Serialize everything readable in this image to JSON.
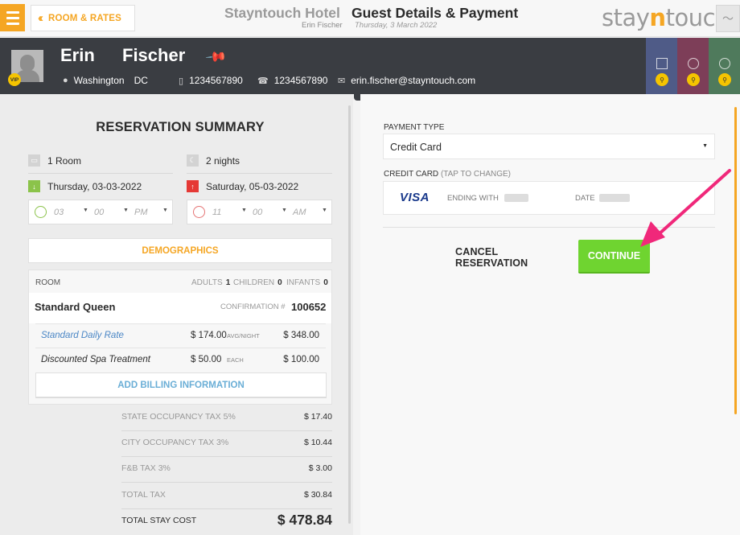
{
  "topbar": {
    "back_label": "ROOM & RATES",
    "hotel_name": "Stayntouch Hotel",
    "hotel_user": "Erin Fischer",
    "page_title": "Guest Details & Payment",
    "page_date": "Thursday, 3 March 2022",
    "logo_prefix": "stay",
    "logo_accent": "n",
    "logo_suffix": "touch"
  },
  "guest": {
    "first_name": "Erin",
    "last_name": "Fischer",
    "vip_badge": "VIP",
    "city": "Washington",
    "state": "DC",
    "mobile": "1234567890",
    "phone": "1234567890",
    "email": "erin.fischer@stayntouch.com",
    "tile_colors": [
      "#4f5b87",
      "#7d3e58",
      "#4f7a5c"
    ]
  },
  "summary": {
    "title": "RESERVATION SUMMARY",
    "rooms": "1 Room",
    "nights": "2 nights",
    "arrival": "Thursday, 03-03-2022",
    "departure": "Saturday, 05-03-2022",
    "arrival_time": {
      "hour": "03",
      "minute": "00",
      "ampm": "PM"
    },
    "departure_time": {
      "hour": "11",
      "minute": "00",
      "ampm": "AM"
    },
    "demographics_label": "DEMOGRAPHICS",
    "room_label": "ROOM",
    "adults_label": "ADULTS",
    "adults": "1",
    "children_label": "CHILDREN",
    "children": "0",
    "infants_label": "INFANTS",
    "infants": "0",
    "room_type": "Standard Queen",
    "confirmation_label": "CONFIRMATION #",
    "confirmation": "100652",
    "rates": [
      {
        "name": "Standard Daily Rate",
        "price": "$ 174.00",
        "unit": "AVG/NIGHT",
        "total": "$ 348.00"
      },
      {
        "name": "Discounted Spa Treatment",
        "price": "$ 50.00",
        "unit": "EACH",
        "total": "$ 100.00"
      }
    ],
    "billing_label": "ADD BILLING INFORMATION",
    "taxes": [
      {
        "label": "STATE OCCUPANCY TAX 5%",
        "value": "$ 17.40"
      },
      {
        "label": "CITY OCCUPANCY TAX 3%",
        "value": "$ 10.44"
      },
      {
        "label": "F&B TAX 3%",
        "value": "$ 3.00"
      },
      {
        "label": "TOTAL TAX",
        "value": "$ 30.84"
      }
    ],
    "total_label": "TOTAL STAY COST",
    "total_value": "$ 478.84"
  },
  "payment": {
    "type_label": "PAYMENT TYPE",
    "type_value": "Credit Card",
    "cc_label": "CREDIT CARD",
    "cc_hint": "(TAP TO CHANGE)",
    "card_brand": "VISA",
    "ending_label": "ENDING WITH",
    "date_label": "DATE",
    "cancel_label": "CANCEL RESERVATION",
    "continue_label": "CONTINUE"
  },
  "colors": {
    "accent": "#f5a623",
    "continue": "#6fd430",
    "annotation_arrow": "#f0287a",
    "link": "#6aaed6"
  }
}
